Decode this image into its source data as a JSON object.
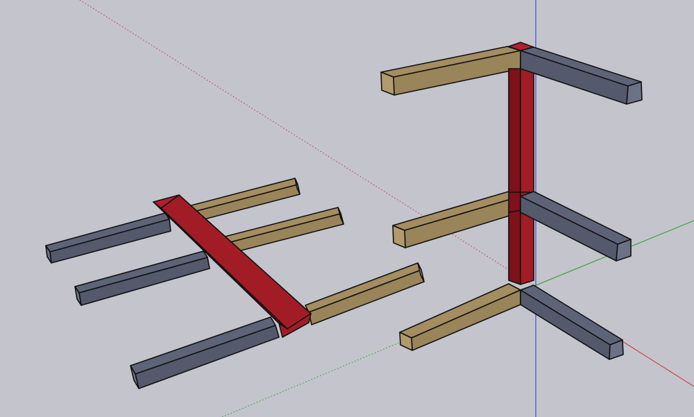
{
  "app": {
    "name": ""
  },
  "viewport": {
    "background": "#c3c4cc",
    "status_text": ""
  },
  "colors": {
    "wood": "#9a8459",
    "wood_top": "#a48d61",
    "wood_end": "#b29a6c",
    "slate": "#545a6c",
    "slate_top": "#5e6478",
    "slate_end": "#6c7286",
    "red": "#a21c26",
    "red_top": "#b02030",
    "red_dark": "#7e1119",
    "edge": "#111111",
    "axis_red": "#d03030",
    "axis_green": "#20a020",
    "axis_blue": "#3030d0"
  },
  "axes": [
    {
      "name": "red-axis-line",
      "color_key": "axis_red",
      "dashed": false
    },
    {
      "name": "red-axis-dotted",
      "color_key": "axis_red",
      "dashed": true
    },
    {
      "name": "green-axis-line",
      "color_key": "axis_green",
      "dashed": false
    },
    {
      "name": "green-axis-dotted",
      "color_key": "axis_green",
      "dashed": true
    },
    {
      "name": "blue-axis-line",
      "color_key": "axis_blue",
      "dashed": false
    }
  ],
  "models": [
    {
      "name": "left-model",
      "components": [
        "wood-member",
        "slate-member",
        "red-triangular-beam"
      ]
    },
    {
      "name": "right-model",
      "components": [
        "wood-member",
        "slate-member",
        "red-post"
      ]
    }
  ]
}
